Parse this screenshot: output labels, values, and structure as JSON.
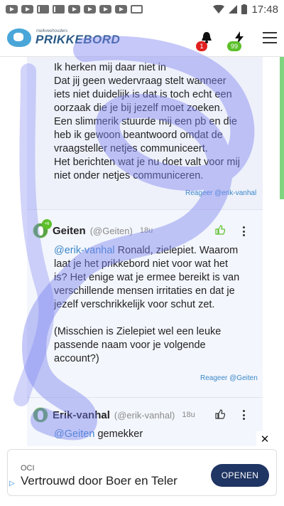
{
  "status_bar": {
    "time": "17:48",
    "icons": [
      "youtube-icon",
      "youtube-icon",
      "gmail-icon",
      "gmail-icon",
      "youtube-icon",
      "youtube-icon",
      "youtube-icon",
      "youtube-icon",
      "calendar-icon"
    ]
  },
  "header": {
    "logo_sub": "melkveehouders",
    "logo_main": "PRIKKEBORD",
    "notif_count": "1",
    "points_count": "99"
  },
  "thread": {
    "first_post_lines": [
      "Ik herken mij daar niet in",
      "Dat jij geen wedervraag stelt wanneer",
      "iets niet duidelijk is dat is toch echt een",
      "oorzaak die je bij jezelf moet zoeken.",
      "Een slimmerik stuurde mij een pb en die",
      "heb ik gewoon beantwoord omdat de",
      "vraagsteller netjes communiceert.",
      "Het berichten wat je nu doet valt voor mij",
      "niet onder netjes communiceren."
    ],
    "first_reply_link": "Reageer @erik-vanhal",
    "comment1": {
      "name": "Geiten",
      "handle": "(@Geiten)",
      "time": "18u",
      "badge": "+6",
      "mention": "@erik-vanhal",
      "body_lines": [
        " Ronald, zielepiet. Waarom",
        "laat je het prikkebord niet voor wat het",
        "is? Het enige wat je ermee bereikt is van",
        "verschillende mensen irritaties en dat je",
        "jezelf verschrikkelijk voor schut zet."
      ],
      "body2_lines": [
        "(Misschien is Zielepiet wel een leuke",
        "passende naam voor je volgende",
        "account?)"
      ],
      "reply_link": "Reageer @Geiten"
    },
    "comment2": {
      "name": "Erik-vanhal",
      "handle": "(@erik-vanhal)",
      "time": "18u",
      "mention": "@Geiten",
      "body": " gemekker"
    }
  },
  "ad": {
    "sponsor": "OCI",
    "title": "Vertrouwd door Boer en Teler",
    "button": "OPENEN",
    "close": "✕"
  }
}
